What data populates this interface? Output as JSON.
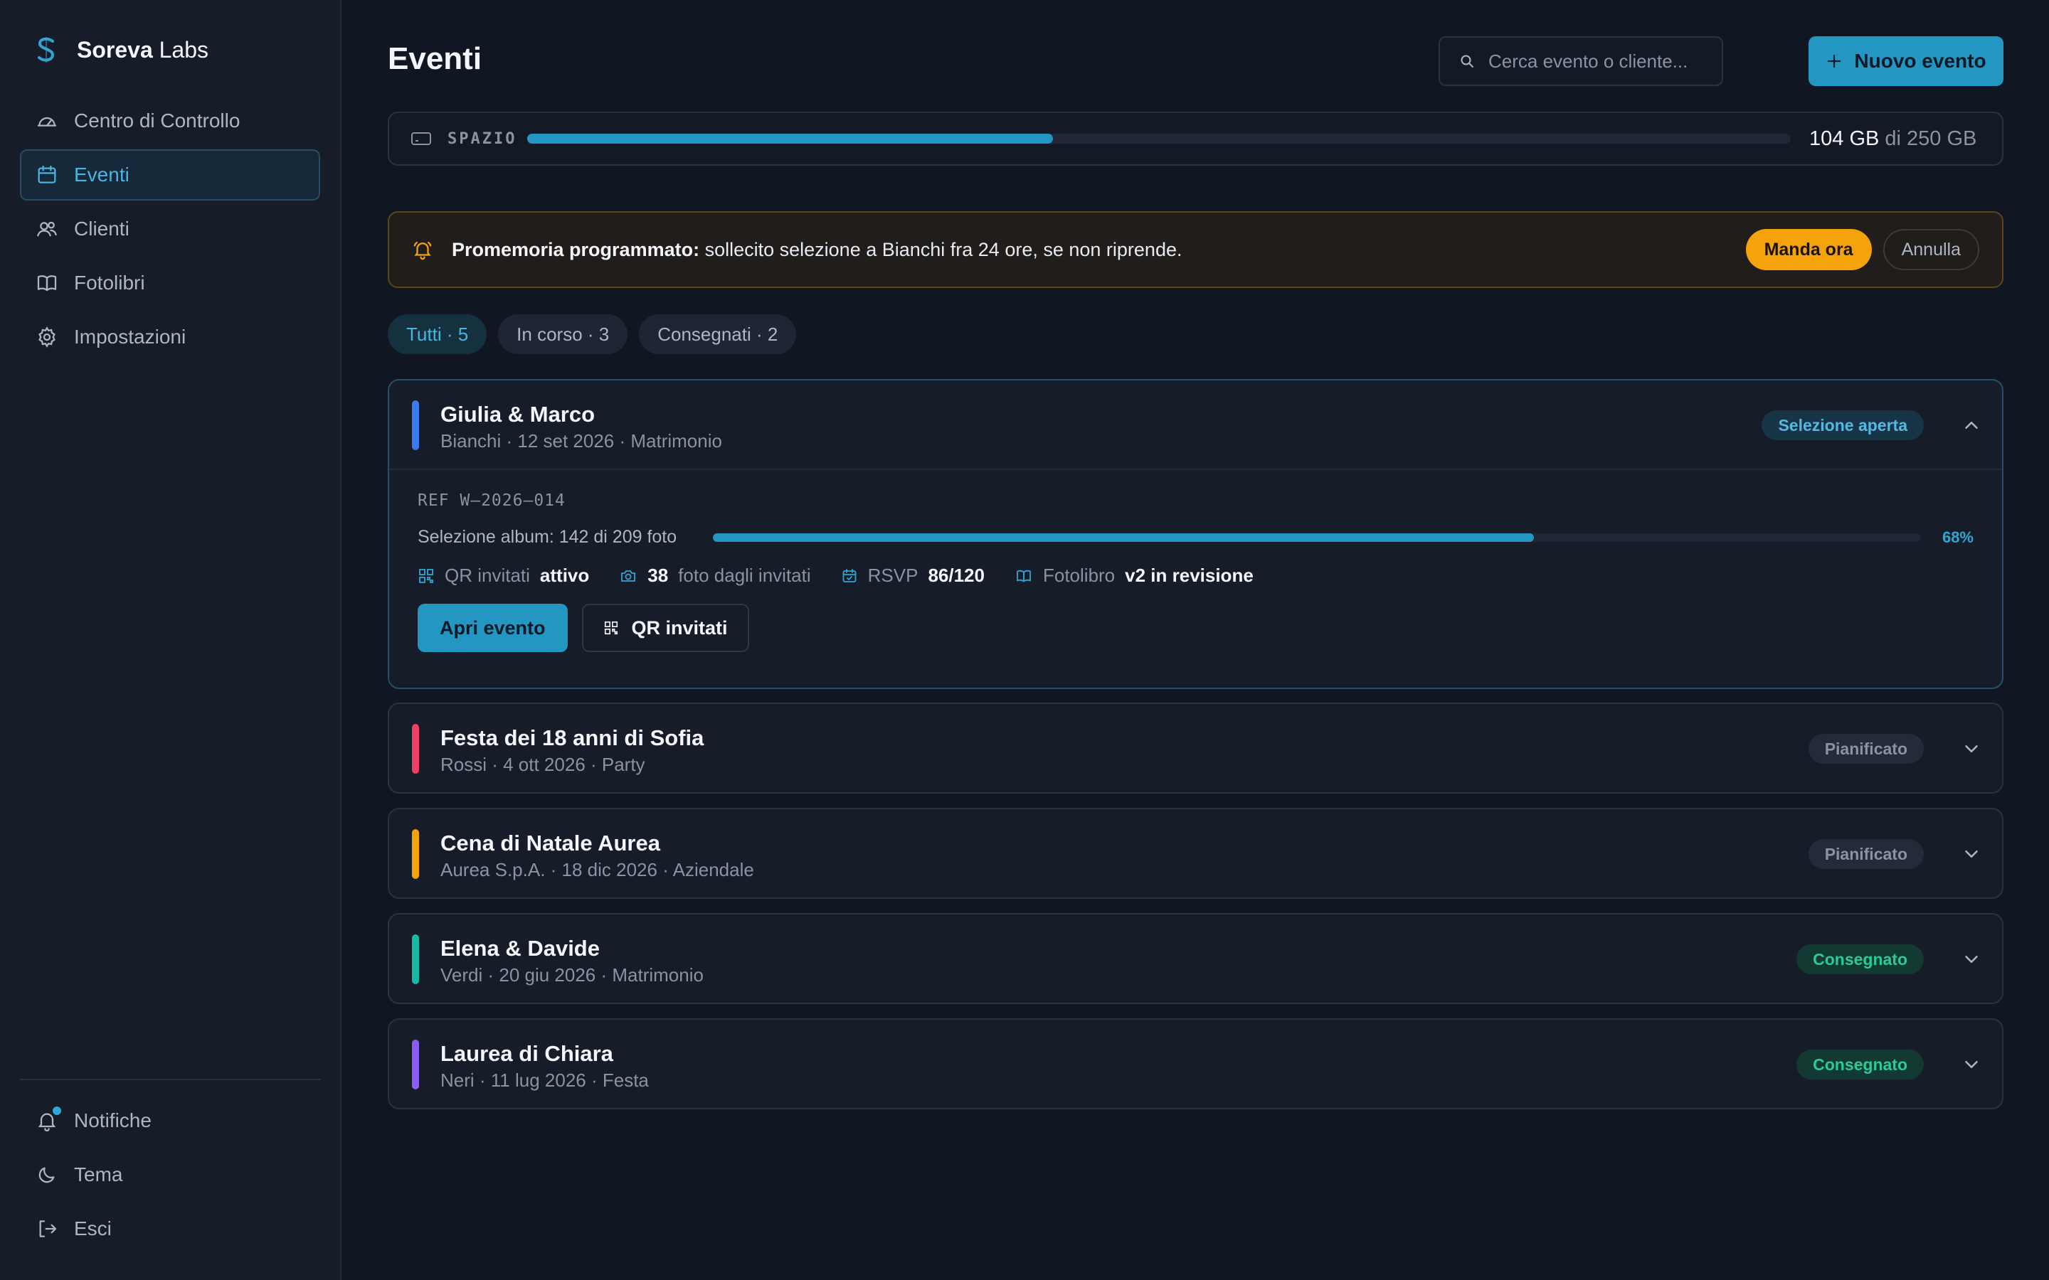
{
  "brand": {
    "name_bold": "Soreva",
    "name_rest": " Labs"
  },
  "sidebar": {
    "items": [
      {
        "label": "Centro di Controllo",
        "icon": "gauge-icon"
      },
      {
        "label": "Eventi",
        "icon": "calendar-icon",
        "active": true
      },
      {
        "label": "Clienti",
        "icon": "users-icon"
      },
      {
        "label": "Fotolibri",
        "icon": "book-icon"
      },
      {
        "label": "Impostazioni",
        "icon": "gear-icon"
      }
    ],
    "bottom": [
      {
        "label": "Notifiche",
        "icon": "bell-icon"
      },
      {
        "label": "Tema",
        "icon": "moon-icon"
      },
      {
        "label": "Esci",
        "icon": "logout-icon"
      }
    ]
  },
  "header": {
    "title": "Eventi",
    "search_placeholder": "Cerca evento o cliente...",
    "new_button": "Nuovo evento"
  },
  "storage": {
    "label": "SPAZIO",
    "used": "104 GB",
    "of": "di 250 GB",
    "used_fraction": 0.416
  },
  "reminder": {
    "title": "Promemoria programmato:",
    "text": " sollecito selezione a Bianchi fra 24 ore, se non riprende.",
    "send_label": "Manda ora",
    "cancel_label": "Annulla"
  },
  "filters": [
    {
      "label": "Tutti · 5",
      "active": true
    },
    {
      "label": "In corso · 3"
    },
    {
      "label": "Consegnati · 2"
    }
  ],
  "events": [
    {
      "title": "Giulia & Marco",
      "subtitle": "Bianchi · 12 set 2026 · Matrimonio",
      "status": "Selezione aperta",
      "accent": "#3b7bf0",
      "expanded": true,
      "ref": "REF W–2026–014",
      "selection_label": "Selezione album: 142 di 209 foto",
      "selection_pct": "68%",
      "selection_fraction": 0.68,
      "meta": {
        "qr_label": "QR invitati",
        "qr_value": "attivo",
        "photos_value": "38",
        "photos_label": "foto dagli invitati",
        "rsvp_label": "RSVP",
        "rsvp_value": "86/120",
        "book_label": "Fotolibro",
        "book_value": "v2 in revisione"
      },
      "open_label": "Apri evento",
      "qr_button": "QR invitati"
    },
    {
      "title": "Festa dei 18 anni di Sofia",
      "subtitle": "Rossi · 4 ott 2026 · Party",
      "status": "Pianificato",
      "accent": "#ef3f63"
    },
    {
      "title": "Cena di Natale Aurea",
      "subtitle": "Aurea S.p.A. · 18 dic 2026 · Aziendale",
      "status": "Pianificato",
      "accent": "#f5a30d"
    },
    {
      "title": "Elena & Davide",
      "subtitle": "Verdi · 20 giu 2026 · Matrimonio",
      "status": "Consegnato",
      "accent": "#17b8a6"
    },
    {
      "title": "Laurea di Chiara",
      "subtitle": "Neri · 11 lug 2026 · Festa",
      "status": "Consegnato",
      "accent": "#8b5cf6"
    }
  ],
  "colors": {
    "accent": "#2496c2",
    "warning": "#f5a30d",
    "success": "#2dc99a",
    "background": "#111722"
  }
}
